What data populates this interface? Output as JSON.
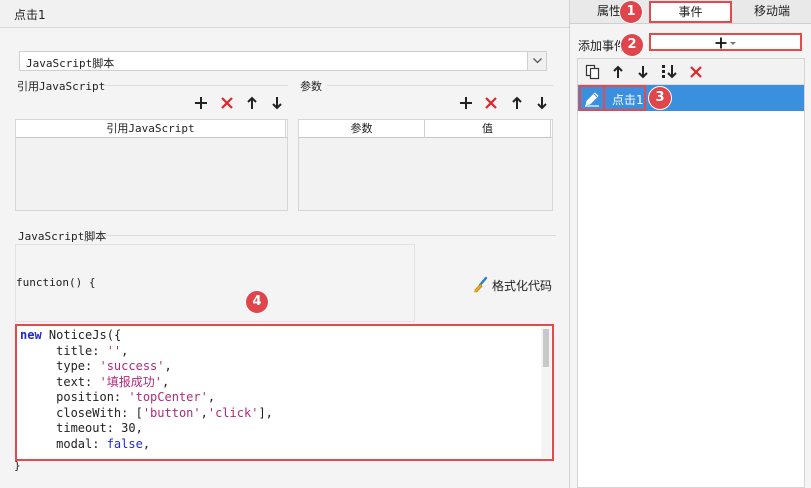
{
  "left_panel": {
    "title": "点击1",
    "script_type_select": {
      "value": "JavaScript脚本"
    },
    "ref_js": {
      "label": "引用JavaScript",
      "column": "引用JavaScript"
    },
    "params": {
      "label": "参数",
      "columns": [
        "参数",
        "值"
      ]
    },
    "script": {
      "label": "JavaScript脚本",
      "function_header": "function() {",
      "format_label": "格式化代码",
      "closing": "}",
      "code_lines": [
        "new NoticeJs({",
        "     title: '',",
        "     type: 'success',",
        "     text: '填报成功',",
        "     position: 'topCenter',",
        "     closeWith: ['button','click'],",
        "     timeout: 30,",
        "     modal: false,"
      ]
    }
  },
  "right_panel": {
    "tabs": [
      {
        "label": "属性",
        "active": false
      },
      {
        "label": "事件",
        "active": true
      },
      {
        "label": "移动端",
        "active": false
      }
    ],
    "add_event_label": "添加事件",
    "events": [
      {
        "name": "点击1",
        "selected": true
      }
    ]
  },
  "markers": [
    "1",
    "2",
    "3",
    "4"
  ],
  "colors": {
    "highlight_border": "#e5484d",
    "marker": "#e0454b",
    "selected_row": "#3a8fde",
    "delete_icon": "#e0262c",
    "keyword": "#1e2ad1",
    "string": "#b02a7a"
  },
  "icons": {
    "add": "plus-icon",
    "delete": "x-icon",
    "up": "arrow-up-icon",
    "down": "arrow-down-icon",
    "copy": "copy-icon",
    "move_to_bottom": "move-down-icon",
    "edit": "pencil-icon",
    "format": "brush-icon",
    "dropdown": "chevron-down-icon"
  }
}
